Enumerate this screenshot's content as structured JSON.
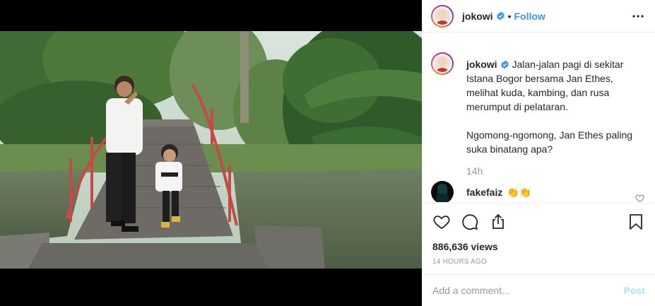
{
  "post": {
    "username": "jokowi",
    "separator": "•",
    "follow_label": "Follow",
    "caption_lines": [
      "Jalan-jalan pagi di sekitar",
      "Istana Bogor bersama Jan Ethes,",
      "melihat kuda, kambing, dan rusa",
      "merumput di pelataran."
    ],
    "caption_lines_2": [
      "Ngomong-ngomong, Jan Ethes paling",
      "suka binatang apa?"
    ],
    "caption_time": "14h",
    "comments": [
      {
        "username": "fakefaiz",
        "text": "👏👏"
      }
    ],
    "views_count": "886,636",
    "views_label": "views",
    "posted_ago": "14 HOURS AGO",
    "add_comment_placeholder": "Add a comment...",
    "post_label": "Post"
  },
  "icons": {
    "more": "more-options-icon",
    "verified": "verified-badge-icon",
    "like": "heart-icon",
    "comment": "comment-bubble-icon",
    "share": "share-icon",
    "save": "bookmark-icon"
  },
  "colors": {
    "link_blue": "#3897f0",
    "post_disabled": "#b2dffc",
    "muted": "#999999",
    "border": "#efefef"
  }
}
